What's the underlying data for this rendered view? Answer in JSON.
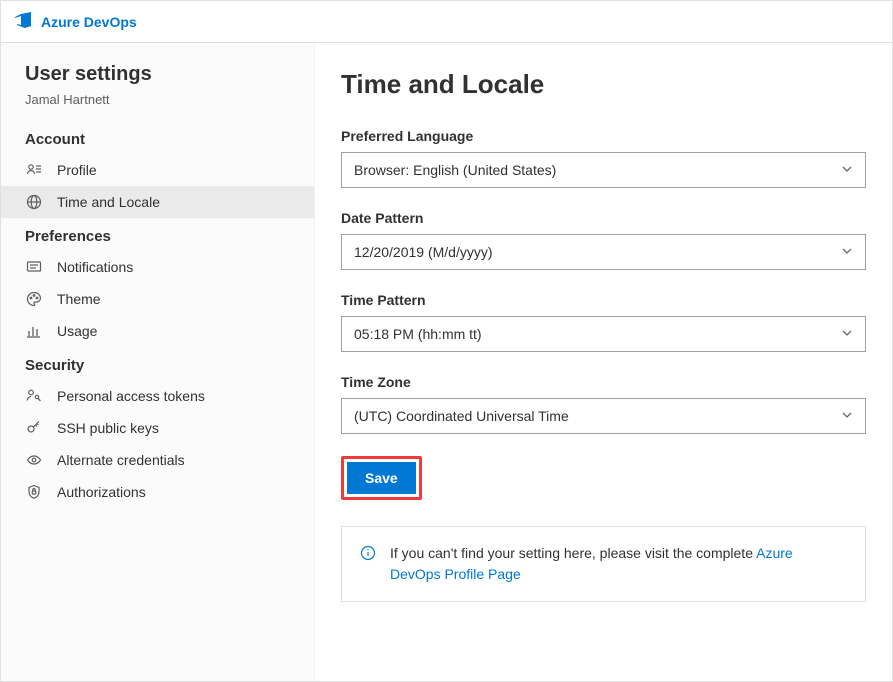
{
  "brand": "Azure DevOps",
  "sidebar": {
    "title": "User settings",
    "subtitle": "Jamal Hartnett",
    "sections": {
      "account": {
        "heading": "Account",
        "items": [
          {
            "label": "Profile"
          },
          {
            "label": "Time and Locale"
          }
        ]
      },
      "preferences": {
        "heading": "Preferences",
        "items": [
          {
            "label": "Notifications"
          },
          {
            "label": "Theme"
          },
          {
            "label": "Usage"
          }
        ]
      },
      "security": {
        "heading": "Security",
        "items": [
          {
            "label": "Personal access tokens"
          },
          {
            "label": "SSH public keys"
          },
          {
            "label": "Alternate credentials"
          },
          {
            "label": "Authorizations"
          }
        ]
      }
    }
  },
  "page": {
    "title": "Time and Locale",
    "fields": {
      "language": {
        "label": "Preferred Language",
        "value": "Browser: English (United States)"
      },
      "datePattern": {
        "label": "Date Pattern",
        "value": "12/20/2019 (M/d/yyyy)"
      },
      "timePattern": {
        "label": "Time Pattern",
        "value": "05:18 PM (hh:mm tt)"
      },
      "timeZone": {
        "label": "Time Zone",
        "value": "(UTC) Coordinated Universal Time"
      }
    },
    "saveLabel": "Save",
    "callout": {
      "prefix": "If you can't find your setting here, please visit the complete ",
      "linkText": "Azure DevOps Profile Page"
    }
  }
}
